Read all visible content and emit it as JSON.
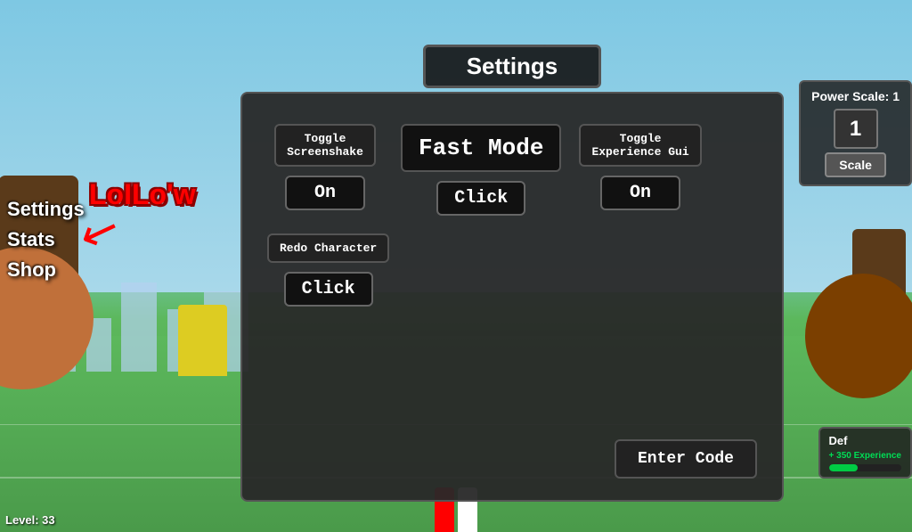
{
  "background": {
    "sky_color": "#87CEEB",
    "grass_color": "#5CB85C"
  },
  "left_nav": {
    "items": [
      "Settings",
      "Stats",
      "Shop"
    ]
  },
  "player": {
    "name": "LoILo'w",
    "level_label": "Level: 33"
  },
  "power_scale": {
    "title": "Power Scale: 1",
    "value": "1",
    "scale_button_label": "Scale"
  },
  "bottom_right": {
    "title": "Def",
    "exp_text": "+ 350 Experience",
    "exp_percent": 40
  },
  "settings_modal": {
    "title": "Settings",
    "buttons": {
      "toggle_screenshake_label": "Toggle\nScreenshake",
      "toggle_screenshake_value": "On",
      "fast_mode_label": "Fast Mode",
      "fast_mode_value": "Click",
      "toggle_experience_gui_label": "Toggle\nExperience Gui",
      "toggle_experience_gui_value": "On",
      "redo_character_label": "Redo Character",
      "redo_character_value": "Click",
      "enter_code_label": "Enter Code"
    }
  }
}
